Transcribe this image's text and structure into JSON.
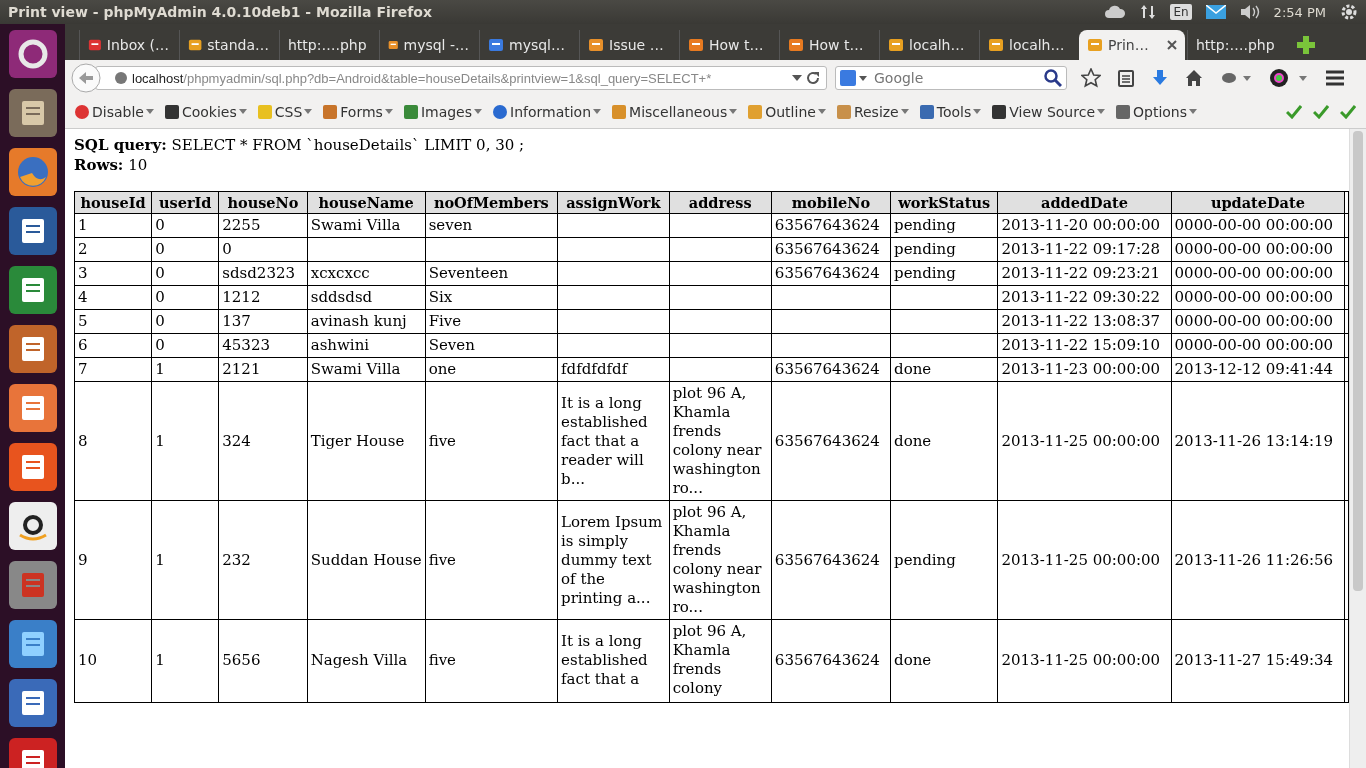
{
  "window": {
    "title": "Print view - phpMyAdmin 4.0.10deb1 - Mozilla Firefox"
  },
  "tray": {
    "language": "En",
    "clock": "2:54 PM"
  },
  "tabs": [
    {
      "label": "Inbox (…",
      "selected": false
    },
    {
      "label": "standa…",
      "selected": false
    },
    {
      "label": "http:….php",
      "selected": false
    },
    {
      "label": "mysql -…",
      "selected": false
    },
    {
      "label": "mysql…",
      "selected": false
    },
    {
      "label": "Issue …",
      "selected": false
    },
    {
      "label": "How t…",
      "selected": false
    },
    {
      "label": "How t…",
      "selected": false
    },
    {
      "label": "localh…",
      "selected": false
    },
    {
      "label": "localh…",
      "selected": false
    },
    {
      "label": "Prin…",
      "selected": true
    },
    {
      "label": "http:….php",
      "selected": false
    }
  ],
  "address_bar": {
    "host": "localhost",
    "path": "/phpmyadmin/sql.php?db=Android&table=houseDetails&printview=1&sql_query=SELECT+*"
  },
  "search": {
    "placeholder": "Google"
  },
  "addon_toolbar": [
    "Disable",
    "Cookies",
    "CSS",
    "Forms",
    "Images",
    "Information",
    "Miscellaneous",
    "Outline",
    "Resize",
    "Tools",
    "View Source",
    "Options"
  ],
  "page": {
    "sql_label": "SQL query:",
    "sql_query": "SELECT * FROM `houseDetails` LIMIT 0, 30 ;",
    "rows_label": "Rows:",
    "rows_count": "10"
  },
  "table": {
    "columns": [
      "houseId",
      "userId",
      "houseNo",
      "houseName",
      "noOfMembers",
      "assignWork",
      "address",
      "mobileNo",
      "workStatus",
      "addedDate",
      "updateDate"
    ],
    "rows": [
      [
        "1",
        "0",
        "2255",
        "Swami Villa",
        "seven",
        null,
        null,
        "63567643624",
        "pending",
        "2013-11-20 00:00:00",
        "0000-00-00 00:00:00"
      ],
      [
        "2",
        "0",
        "0",
        null,
        null,
        null,
        null,
        "63567643624",
        "pending",
        "2013-11-22 09:17:28",
        "0000-00-00 00:00:00"
      ],
      [
        "3",
        "0",
        "sdsd2323",
        "xcxcxcc",
        "Seventeen",
        null,
        null,
        "63567643624",
        "pending",
        "2013-11-22 09:23:21",
        "0000-00-00 00:00:00"
      ],
      [
        "4",
        "0",
        "1212",
        "sddsdsd",
        "Six",
        null,
        null,
        null,
        null,
        "2013-11-22 09:30:22",
        "0000-00-00 00:00:00"
      ],
      [
        "5",
        "0",
        "137",
        "avinash kunj",
        "Five",
        null,
        null,
        null,
        null,
        "2013-11-22 13:08:37",
        "0000-00-00 00:00:00"
      ],
      [
        "6",
        "0",
        "45323",
        "ashwini",
        "Seven",
        null,
        null,
        null,
        null,
        "2013-11-22 15:09:10",
        "0000-00-00 00:00:00"
      ],
      [
        "7",
        "1",
        "2121",
        "Swami Villa",
        "one",
        "fdfdfdfdf",
        null,
        "63567643624",
        "done",
        "2013-11-23 00:00:00",
        "2013-12-12 09:41:44"
      ],
      [
        "8",
        "1",
        "324",
        "Tiger House",
        "five",
        "It is a long established fact that a reader will b...",
        "plot 96 A, Khamla frends colony near washington ro...",
        "63567643624",
        "done",
        "2013-11-25 00:00:00",
        "2013-11-26 13:14:19"
      ],
      [
        "9",
        "1",
        "232",
        "Suddan House",
        "five",
        "Lorem Ipsum is simply dummy text of the printing a...",
        "plot 96 A, Khamla frends colony near washington ro...",
        "63567643624",
        "pending",
        "2013-11-25 00:00:00",
        "2013-11-26 11:26:56"
      ],
      [
        "10",
        "1",
        "5656",
        "Nagesh Villa",
        "five",
        "It is a long established fact that a",
        "plot 96 A, Khamla frends colony",
        "63567643624",
        "done",
        "2013-11-25 00:00:00",
        "2013-11-27 15:49:34"
      ]
    ]
  }
}
